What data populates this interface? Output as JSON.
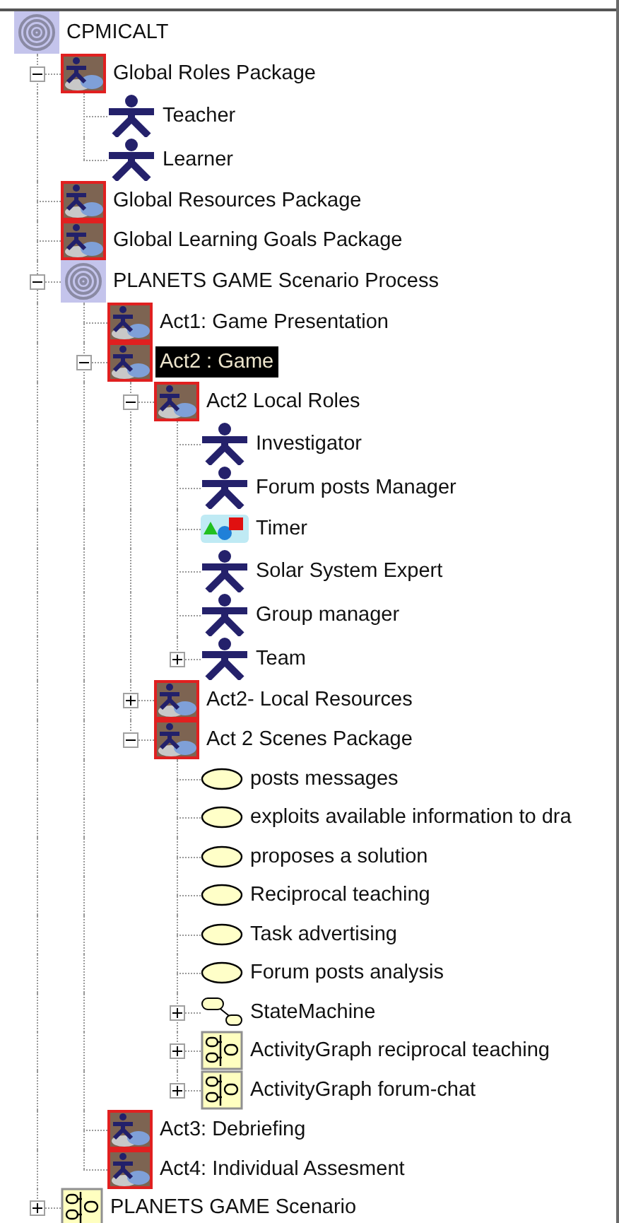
{
  "tree": {
    "label": "CPMICALT",
    "kind": "model",
    "selected": false,
    "children": [
      {
        "label": "Global Roles Package",
        "kind": "package",
        "selected": false,
        "expanded": true,
        "children": [
          {
            "label": "Teacher",
            "kind": "actor",
            "selected": false
          },
          {
            "label": "Learner",
            "kind": "actor",
            "selected": false
          }
        ]
      },
      {
        "label": "Global Resources Package",
        "kind": "package",
        "selected": false
      },
      {
        "label": "Global Learning Goals Package",
        "kind": "package",
        "selected": false
      },
      {
        "label": "PLANETS GAME Scenario Process",
        "kind": "model",
        "selected": false,
        "expanded": true,
        "children": [
          {
            "label": "Act1: Game Presentation",
            "kind": "package",
            "selected": false
          },
          {
            "label": "Act2 : Game",
            "kind": "package",
            "selected": true,
            "expanded": true,
            "children": [
              {
                "label": "Act2 Local Roles",
                "kind": "package",
                "selected": false,
                "expanded": true,
                "children": [
                  {
                    "label": "Investigator",
                    "kind": "actor",
                    "selected": false
                  },
                  {
                    "label": "Forum posts Manager",
                    "kind": "actor",
                    "selected": false
                  },
                  {
                    "label": "Timer",
                    "kind": "class",
                    "selected": false
                  },
                  {
                    "label": "Solar System Expert",
                    "kind": "actor",
                    "selected": false
                  },
                  {
                    "label": "Group manager",
                    "kind": "actor",
                    "selected": false
                  },
                  {
                    "label": "Team",
                    "kind": "actor",
                    "selected": false,
                    "expanded": false
                  }
                ]
              },
              {
                "label": "Act2- Local Resources",
                "kind": "package",
                "selected": false,
                "expanded": false
              },
              {
                "label": "Act 2 Scenes Package",
                "kind": "package",
                "selected": false,
                "expanded": true,
                "children": [
                  {
                    "label": "posts messages",
                    "kind": "usecase",
                    "selected": false
                  },
                  {
                    "label": "exploits available information to dra",
                    "kind": "usecase",
                    "selected": false
                  },
                  {
                    "label": "proposes a solution",
                    "kind": "usecase",
                    "selected": false
                  },
                  {
                    "label": "Reciprocal teaching",
                    "kind": "usecase",
                    "selected": false
                  },
                  {
                    "label": "Task advertising",
                    "kind": "usecase",
                    "selected": false
                  },
                  {
                    "label": "Forum posts analysis",
                    "kind": "usecase",
                    "selected": false
                  },
                  {
                    "label": "StateMachine",
                    "kind": "statemachine",
                    "selected": false,
                    "expanded": false
                  },
                  {
                    "label": "ActivityGraph reciprocal teaching",
                    "kind": "activitygraph",
                    "selected": false,
                    "expanded": false
                  },
                  {
                    "label": "ActivityGraph  forum-chat",
                    "kind": "activitygraph",
                    "selected": false,
                    "expanded": false
                  }
                ]
              }
            ]
          },
          {
            "label": "Act3: Debriefing",
            "kind": "package",
            "selected": false
          },
          {
            "label": "Act4: Individual Assesment",
            "kind": "package",
            "selected": false
          }
        ]
      },
      {
        "label": "PLANETS GAME Scenario",
        "kind": "activitygraph",
        "selected": false,
        "expanded": false
      }
    ]
  }
}
